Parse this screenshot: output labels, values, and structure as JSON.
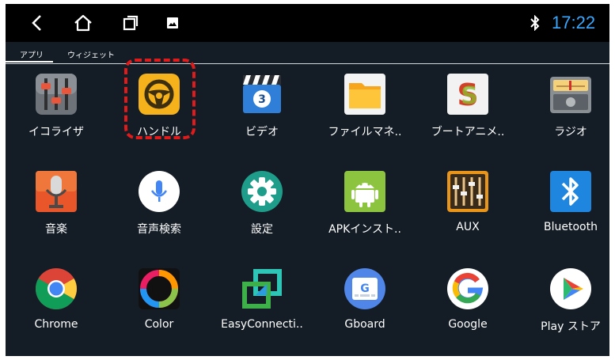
{
  "status_bar": {
    "clock": "17:22",
    "clock_color": "#39a8ff",
    "icons": [
      "back-icon",
      "home-icon",
      "recent-apps-icon",
      "gallery-icon",
      "bluetooth-icon"
    ]
  },
  "tabs": [
    {
      "label": "アプリ",
      "selected": true
    },
    {
      "label": "ウィジェット",
      "selected": false
    }
  ],
  "apps": {
    "equalizer": "イコライザ",
    "steering": "ハンドル",
    "video": "ビデオ",
    "file_manager": "ファイルマネ..",
    "boot_animation": "ブートアニメ..",
    "radio": "ラジオ",
    "music": "音楽",
    "voice_search": "音声検索",
    "settings": "設定",
    "apk_installer": "APKインスト..",
    "aux": "AUX",
    "bluetooth": "Bluetooth",
    "chrome": "Chrome",
    "color": "Color",
    "easyconnection": "EasyConnecti..",
    "gboard": "Gboard",
    "google": "Google",
    "play_store": "Play ストア"
  },
  "highlight": {
    "target": "ハンドル",
    "color": "#e01b1b"
  }
}
